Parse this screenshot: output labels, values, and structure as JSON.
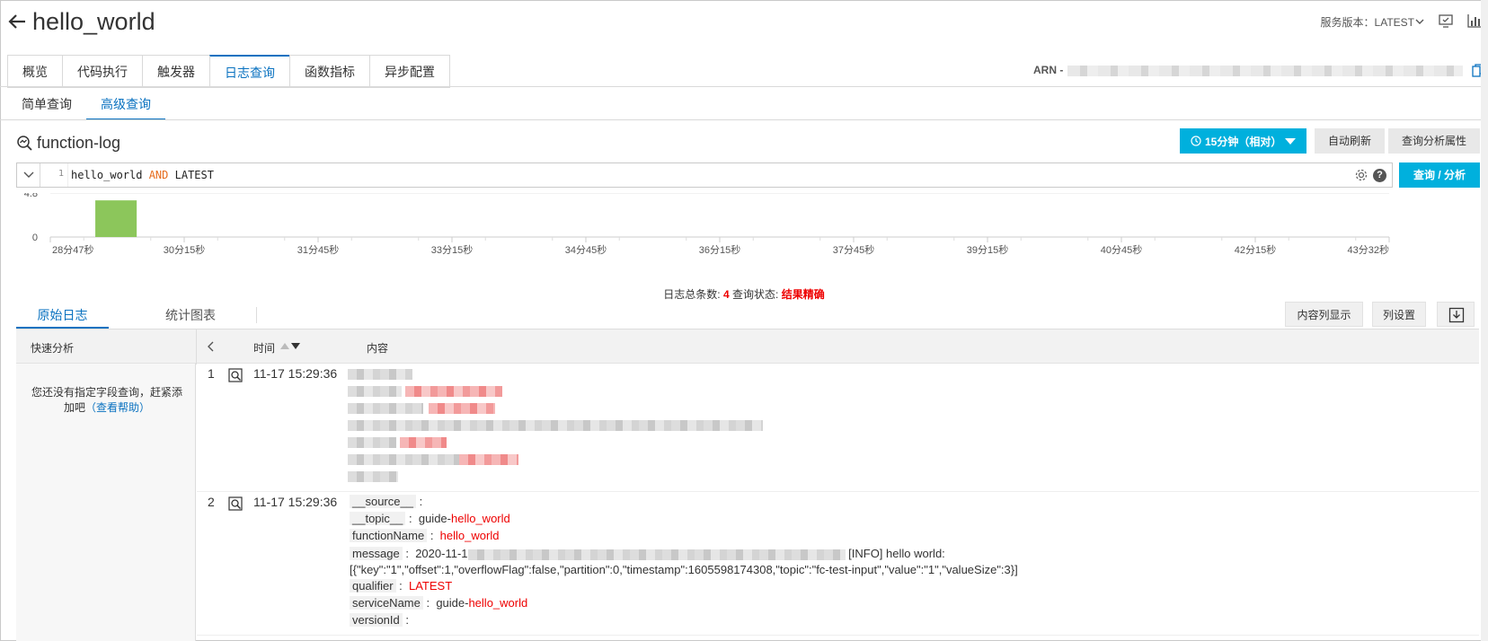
{
  "header": {
    "title": "hello_world",
    "service_version": "服务版本：LATEST"
  },
  "main_tabs": [
    {
      "label": "概览"
    },
    {
      "label": "代码执行"
    },
    {
      "label": "触发器"
    },
    {
      "label": "日志查询"
    },
    {
      "label": "函数指标"
    },
    {
      "label": "异步配置"
    }
  ],
  "arn_label": "ARN -",
  "sub_tabs": [
    {
      "label": "简单查询"
    },
    {
      "label": "高级查询"
    }
  ],
  "logstore": {
    "name": "function-log",
    "time_range_label": "15分钟（相对）",
    "auto_refresh_label": "自动刷新",
    "query_attr_label": "查询分析属性",
    "search_label": "查询 / 分析"
  },
  "query": {
    "line_number": "1",
    "before": "hello_world ",
    "keyword": "AND",
    "after": " LATEST"
  },
  "chart_data": {
    "type": "bar",
    "ylim": [
      0,
      4.8
    ],
    "y_ticks": [
      "4.8",
      "0"
    ],
    "x_ticks": [
      "28分47秒",
      "30分15秒",
      "31分45秒",
      "33分15秒",
      "34分45秒",
      "36分15秒",
      "37分45秒",
      "39分15秒",
      "40分45秒",
      "42分15秒",
      "43分32秒"
    ],
    "bars": [
      {
        "bucket": 1,
        "value": 4
      }
    ],
    "bucket_count": 31,
    "color": "#8cc65b"
  },
  "summary": {
    "total_label": "日志总条数:",
    "total_value": "4",
    "status_label": "查询状态:",
    "status_value": "结果精确"
  },
  "result_tabs": {
    "raw": "原始日志",
    "chart": "统计图表",
    "column_display": "内容列显示",
    "column_settings": "列设置"
  },
  "table": {
    "quick_analysis": "快速分析",
    "time_header": "时间",
    "content_header": "内容",
    "sidebar_text": "您还没有指定字段查询，赶紧添加吧",
    "sidebar_link": "（查看帮助）"
  },
  "rows": [
    {
      "index": "1",
      "time": "11-17 15:29:36"
    },
    {
      "index": "2",
      "time": "11-17 15:29:36",
      "fields": {
        "source_key": "__source__",
        "topic_key": "__topic__",
        "topic_prefix": "guide-",
        "topic_hl": "hello_world",
        "function_key": "functionName",
        "function_val": "hello_world",
        "message_key": "message",
        "message_prefix": "2020-11-1",
        "message_rest": "[INFO] hello world:[{\"key\":\"1\",\"offset\":1,\"overflowFlag\":false,\"partition\":0,\"timestamp\":1605598174308,\"topic\":\"fc-test-input\",\"value\":\"1\",\"valueSize\":3}]",
        "qualifier_key": "qualifier",
        "qualifier_val": "LATEST",
        "service_key": "serviceName",
        "service_prefix": "guide-",
        "service_hl": "hello_world",
        "version_key": "versionId"
      }
    }
  ]
}
